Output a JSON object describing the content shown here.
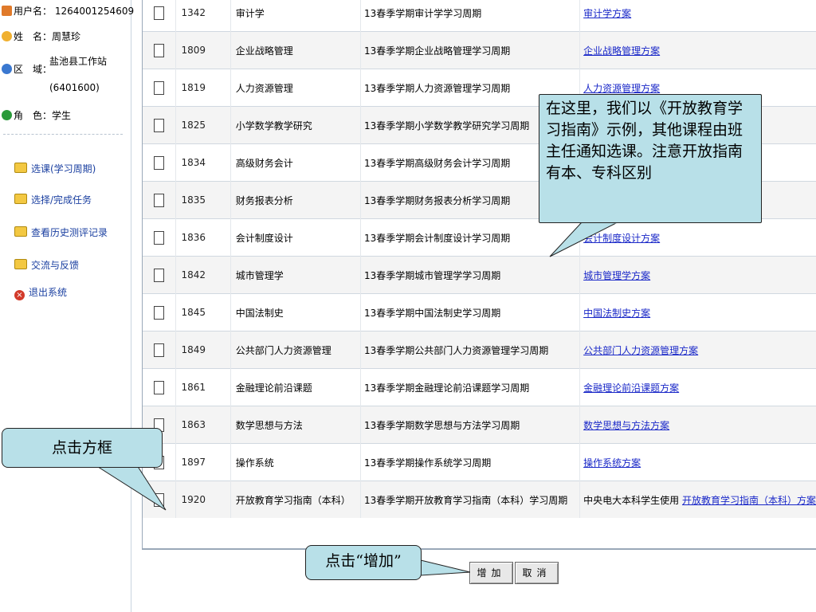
{
  "user": {
    "username_label": "用户名：",
    "username_value": "1264001254609",
    "name_label": "姓　名：",
    "name_value": "周慧珍",
    "region_label": "区　域：",
    "region_value": "盐池县工作站",
    "region_code": "(6401600)",
    "role_label": "角　色：",
    "role_value": "学生"
  },
  "nav": {
    "items": [
      {
        "label": "选课(学习周期)"
      },
      {
        "label": "选择/完成任务"
      },
      {
        "label": "查看历史测评记录"
      },
      {
        "label": "交流与反馈"
      },
      {
        "label": "退出系统"
      }
    ]
  },
  "courses": [
    {
      "code": "1342",
      "name": "审计学",
      "period": "13春季学期审计学学习周期",
      "note": "",
      "plan": "审计学方案"
    },
    {
      "code": "1809",
      "name": "企业战略管理",
      "period": "13春季学期企业战略管理学习周期",
      "note": "",
      "plan": "企业战略管理方案"
    },
    {
      "code": "1819",
      "name": "人力资源管理",
      "period": "13春季学期人力资源管理学习周期",
      "note": "",
      "plan": "人力资源管理方案"
    },
    {
      "code": "1825",
      "name": "小学数学教学研究",
      "period": "13春季学期小学数学教学研究学习周期",
      "note": "",
      "plan": ""
    },
    {
      "code": "1834",
      "name": "高级财务会计",
      "period": "13春季学期高级财务会计学习周期",
      "note": "",
      "plan": ""
    },
    {
      "code": "1835",
      "name": "财务报表分析",
      "period": "13春季学期财务报表分析学习周期",
      "note": "",
      "plan": ""
    },
    {
      "code": "1836",
      "name": "会计制度设计",
      "period": "13春季学期会计制度设计学习周期",
      "note": "",
      "plan": "会计制度设计方案"
    },
    {
      "code": "1842",
      "name": "城市管理学",
      "period": "13春季学期城市管理学学习周期",
      "note": "",
      "plan": "城市管理学方案"
    },
    {
      "code": "1845",
      "name": "中国法制史",
      "period": "13春季学期中国法制史学习周期",
      "note": "",
      "plan": "中国法制史方案"
    },
    {
      "code": "1849",
      "name": "公共部门人力资源管理",
      "period": "13春季学期公共部门人力资源管理学习周期",
      "note": "",
      "plan": "公共部门人力资源管理方案"
    },
    {
      "code": "1861",
      "name": "金融理论前沿课题",
      "period": "13春季学期金融理论前沿课题学习周期",
      "note": "",
      "plan": "金融理论前沿课题方案"
    },
    {
      "code": "1863",
      "name": "数学思想与方法",
      "period": "13春季学期数学思想与方法学习周期",
      "note": "",
      "plan": "数学思想与方法方案"
    },
    {
      "code": "1897",
      "name": "操作系统",
      "period": "13春季学期操作系统学习周期",
      "note": "",
      "plan": "操作系统方案"
    },
    {
      "code": "1920",
      "name": "开放教育学习指南（本科）",
      "period": "13春季学期开放教育学习指南（本科）学习周期",
      "note": "中央电大本科学生使用",
      "plan": "开放教育学习指南（本科）方案"
    }
  ],
  "buttons": {
    "add": "增加",
    "cancel": "取消"
  },
  "callouts": {
    "main": "在这里，我们以《开放教育学习指南》示例，其他课程由班主任通知选课。注意开放指南有本、专科区别",
    "checkbox": "点击方框",
    "add": "点击“增加”"
  },
  "colors": {
    "link": "#1a28c8",
    "nav_link": "#1a3fa0",
    "callout_bg": "#b8e0e8"
  }
}
